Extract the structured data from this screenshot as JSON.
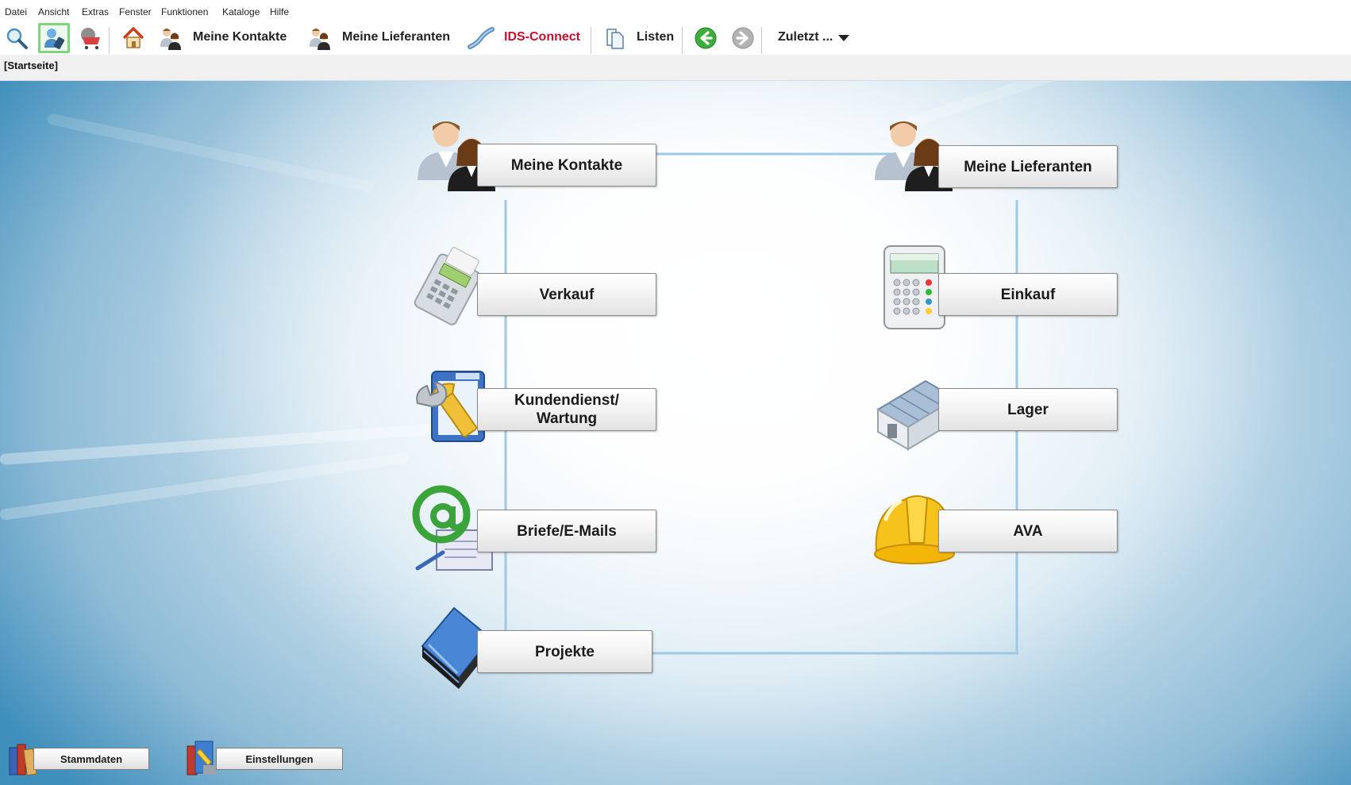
{
  "menu": [
    "Datei",
    "Ansicht",
    "Extras",
    "Fenster",
    "Funktionen",
    "Kataloge",
    "Hilfe"
  ],
  "toolbar": {
    "contacts_label": "Meine Kontakte",
    "suppliers_label": "Meine Lieferanten",
    "ids_label": "IDS-Connect",
    "lists_label": "Listen",
    "recent_label": "Zuletzt ...",
    "ids_color": "#c8102e"
  },
  "tab": {
    "label": "[Startseite]"
  },
  "tiles": {
    "kontakte": "Meine Kontakte",
    "lieferanten": "Meine Lieferanten",
    "verkauf": "Verkauf",
    "einkauf": "Einkauf",
    "kundendienst": "Kundendienst/ Wartung",
    "lager": "Lager",
    "briefe": "Briefe/E-Mails",
    "ava": "AVA",
    "projekte": "Projekte"
  },
  "bottom": {
    "stammdaten": "Stammdaten",
    "einstellungen": "Einstellungen"
  },
  "icons": {
    "search": "search-icon",
    "phone_user": "phone-user-icon",
    "cart": "shopping-cart-icon",
    "home": "home-icon",
    "contacts": "people-icon",
    "suppliers": "people-icon",
    "ids": "network-cable-icon",
    "lists": "document-copy-icon",
    "back": "arrow-left-icon",
    "forward": "arrow-right-icon",
    "dropdown": "caret-down-icon"
  }
}
